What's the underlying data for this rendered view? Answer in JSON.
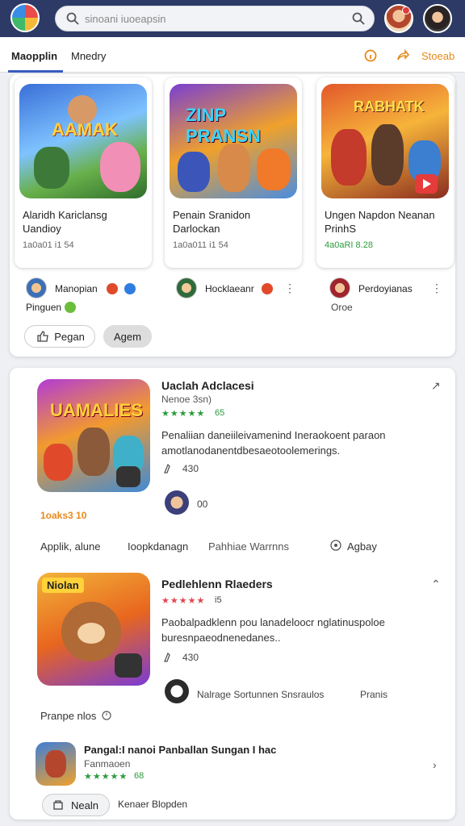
{
  "header": {
    "search_placeholder": "sinoani iuoeapsin"
  },
  "tabs": [
    {
      "label": "Maopplin"
    },
    {
      "label": "Mnedry"
    }
  ],
  "tab_actions": {
    "action_label": "Stoeab"
  },
  "featured": [
    {
      "title": "Alaridh Kariclansg Uandioy",
      "meta": "1a0a01 i1 54",
      "meta_green": false,
      "art": "AAMAK"
    },
    {
      "title": "Penain Sranidon Darlockan",
      "meta": "1a0a011 i1 54",
      "meta_green": false,
      "art": "ZINP PRANSN"
    },
    {
      "title": "Ungen Napdon Neanan PrinhS",
      "meta": "4a0aRI 8.28",
      "meta_green": true,
      "art": "RABHATK"
    }
  ],
  "publishers": [
    {
      "name": "Manopian",
      "sub": "Pinguen"
    },
    {
      "name": "Hocklaeanr"
    },
    {
      "name": "Perdoyianas",
      "sub": "Oroe"
    }
  ],
  "chips": [
    {
      "label": "Pegan"
    },
    {
      "label": "Agem"
    }
  ],
  "apps": [
    {
      "title": "Uaclah Adclacesi",
      "sub": "Nenoe 3sn)",
      "stars": "★★★★★",
      "rating": "65",
      "desc": "Penaliian daneiileivamenind Ineraokoent paraon amotlanodanentdbesaeotoolemerings.",
      "likes": "430",
      "reply": "00",
      "price": "1oaks3 10",
      "art": "UAMALIES"
    },
    {
      "title": "Pedlehlenn Rlaeders",
      "stars": "★★★★★",
      "rating": "i5",
      "desc": "Paobalpadklenn pou lanadeloocr nglatinuspoloe buresnpaeodnenedanes..",
      "likes": "430",
      "footer": "Nalrage Sortunnen Snsraulos",
      "tag": "Pranis",
      "art": "Niolan"
    },
    {
      "title": "Pangal:I nanoi Panballan Sungan I hac",
      "sub": "Fanmaoen",
      "stars": "★★★★★",
      "rating": "68"
    }
  ],
  "links_row": [
    {
      "label": "Applik, alune"
    },
    {
      "label": "Ioopkdanagn"
    },
    {
      "label": "Pahhiae  Warrnns"
    },
    {
      "label": "Agbay"
    }
  ],
  "footer_row": {
    "label": "Pranpe nlos"
  },
  "bottom_actions": [
    {
      "label": "Nealn"
    },
    {
      "label": "Kenaer Blopden"
    }
  ],
  "colors": {
    "header_bg": "#2d3a66",
    "accent": "#3a5bbf",
    "orange": "#e68a1c",
    "green": "#2d9a3d"
  }
}
